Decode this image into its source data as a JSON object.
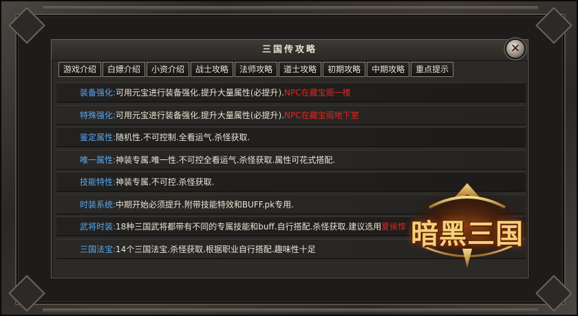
{
  "window": {
    "title": "三国传攻略",
    "close_icon": "close-icon",
    "close_glyph": "✕"
  },
  "tabs": [
    {
      "label": "游戏介绍"
    },
    {
      "label": "白嫖介绍"
    },
    {
      "label": "小资介绍"
    },
    {
      "label": "战士攻略"
    },
    {
      "label": "法师攻略"
    },
    {
      "label": "道士攻略"
    },
    {
      "label": "初期攻略"
    },
    {
      "label": "中期攻略"
    },
    {
      "label": "重点提示"
    }
  ],
  "rows": [
    {
      "label": "装备强化:",
      "text": "可用元宝进行装备强化.提升大量属性(必提升).",
      "highlight": "NPC在藏宝阁一楼"
    },
    {
      "label": "特殊强化:",
      "text": "可用元宝进行装备强化.提升大量属性(必提升).",
      "highlight": "NPC在藏宝阁地下室"
    },
    {
      "label": "鉴定属性:",
      "text": "随机性.不可控制.全看运气.杀怪获取.",
      "highlight": ""
    },
    {
      "label": "唯一属性:",
      "text": "神装专属.唯一性.不可控全看运气.杀怪获取.属性可花式搭配.",
      "highlight": ""
    },
    {
      "label": "技能特性:",
      "text": "神装专属.不可控.杀怪获取.",
      "highlight": ""
    },
    {
      "label": "时装系统:",
      "text": "中期开始必须提升.附带技能特效和BUFF.pk专用.",
      "highlight": ""
    },
    {
      "label": "武将时装:",
      "text": "18种三国武将都带有不同的专属技能和buff.自行搭配.杀怪获取.建议选用",
      "highlight": "夏侯惇"
    },
    {
      "label": "三国法宝:",
      "text": "14个三国法宝.杀怪获取.根据职业自行搭配.趣味性十足",
      "highlight": ""
    }
  ],
  "logo": {
    "text": "暗黑三国"
  }
}
